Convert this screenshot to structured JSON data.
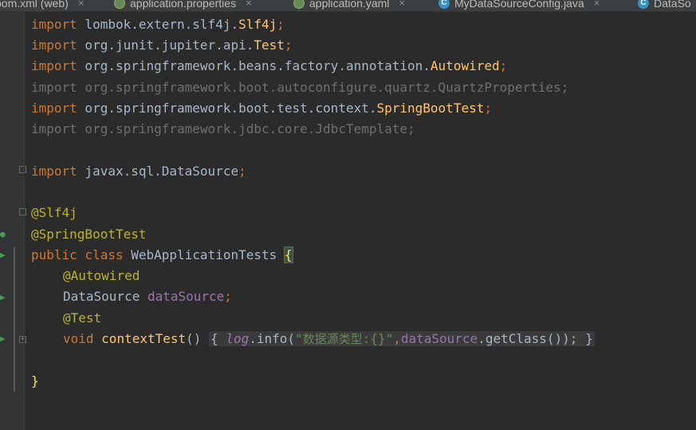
{
  "tabs": [
    {
      "label": "pom.xml (web)",
      "icon": "maven-icon"
    },
    {
      "label": "application.properties",
      "icon": "spring-leaf-icon"
    },
    {
      "label": "application.yaml",
      "icon": "spring-leaf-icon"
    },
    {
      "label": "MyDataSourceConfig.java",
      "icon": "class-icon"
    },
    {
      "label": "DataSo",
      "icon": "class-icon"
    }
  ],
  "tab_close": "×",
  "code": {
    "import_kw": "import",
    "lines": {
      "l1_pkg": " lombok.extern.slf4j.",
      "l1_cls": "Slf4j",
      "l2_pkg": " org.junit.jupiter.api.",
      "l2_cls": "Test",
      "l3_pkg": " org.springframework.beans.factory.annotation.",
      "l3_cls": "Autowired",
      "l4": "import org.springframework.boot.autoconfigure.quartz.QuartzProperties;",
      "l5_pkg": " org.springframework.boot.test.context.",
      "l5_cls": "SpringBootTest",
      "l6": "import org.springframework.jdbc.core.JdbcTemplate;",
      "l8_pkg": " javax.sql.DataSource",
      "semi": ";",
      "ann_slf4j": "@Slf4j",
      "ann_sbt": "@SpringBootTest",
      "public_class": "public class",
      "class_name": " WebApplicationTests ",
      "open_brace": "{",
      "ann_autowired": "@Autowired",
      "ds_type": "DataSource ",
      "ds_field": "dataSource",
      "ann_test": "@Test",
      "void_kw": "void",
      "method_name": "contextTest",
      "parens": "()",
      "fold_open": "{",
      "log": "log",
      "info_call": ".info(",
      "str_open": "\"",
      "str_cn": "数据源类型",
      "str_rest": ":{}\"",
      "comma": ",",
      "ds_ref": "dataSource",
      "getclass": ".getClass());",
      "fold_close": "}",
      "close_brace": "}"
    }
  }
}
